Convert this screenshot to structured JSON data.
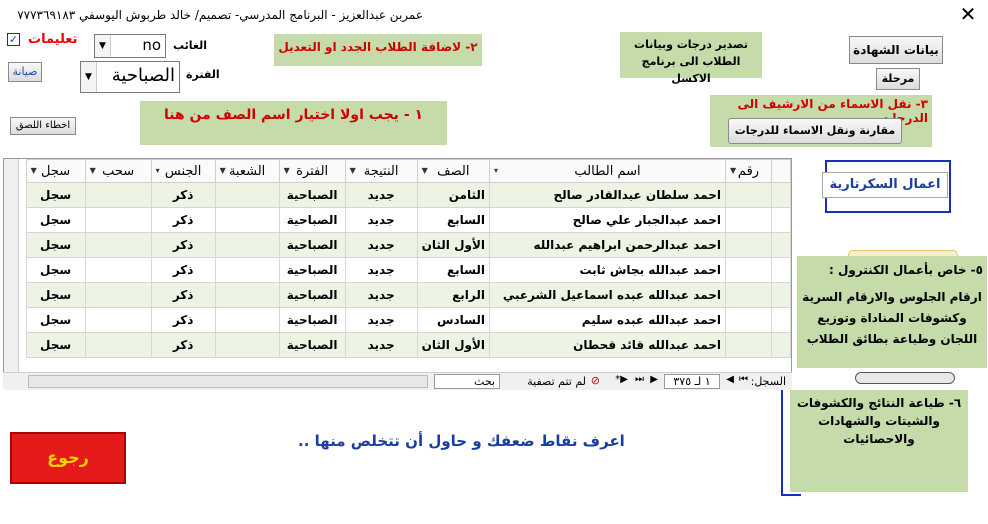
{
  "titlebar": {
    "title": "عمربن عبدالعزيز  - البرنامج المدرسي- تصميم/ خالد طربوش اليوسفي ٧٧٧٣٦٩١٨٣",
    "close": "✕"
  },
  "top_left": {
    "instructions_checked": "✓",
    "instructions_label": "تعليمات",
    "maintenance_button": "صيانة",
    "errors_button": "اخطاء اللصق"
  },
  "filters": {
    "absent_label": "الغائب",
    "absent_value": "no",
    "period_label": "الفترة",
    "period_value": "الصباحية"
  },
  "notes": {
    "add_students": "٢- لاضافة الطلاب الجدد او التعديل",
    "choose_class": "١ - يجب اولا اختيار اسم الصف من هنا",
    "export": "تصدير درجات وبيانات الطلاب الى برنامج الاكسل",
    "move_names": "٣- نقل الاسماء من الارشيف الى الدرجات",
    "control_title": "٥- خاص بأعمال الكنترول :",
    "control_body": "ارقام الجلوس والارقام السرية وكشوفات المناداة وتوزيع اللجان وطباعة بطائق الطلاب",
    "print_results": "٦-  طباعة النتائج والكشوفات والشيتات والشهادات والاحصائيات"
  },
  "buttons": {
    "certificate_data": "بيانات الشهادة",
    "stage": "مرحلة",
    "compare_move": "مقارنة ونقل الاسماء للدرجات",
    "secretary": "اعمال السكرتارية",
    "back": "رجوع"
  },
  "table": {
    "headers": [
      "رقم",
      "اسم الطالب",
      "الصف",
      "النتيجة",
      "الفترة",
      "الشعبة",
      "الجنس",
      "سحب",
      "سجل"
    ],
    "rows": [
      {
        "name": "احمد سلطان عبدالقادر صالح",
        "grade": "الثامن",
        "result": "جديد",
        "period": "الصباحية",
        "section": "",
        "gender": "ذكر",
        "withdraw": "",
        "record": "سجل"
      },
      {
        "name": "احمد عبدالجبار علي صالح",
        "grade": "السابع",
        "result": "جديد",
        "period": "الصباحية",
        "section": "",
        "gender": "ذكر",
        "withdraw": "",
        "record": "سجل"
      },
      {
        "name": "احمد عبدالرحمن ابراهيم عبدالله",
        "grade": "الأول الثان",
        "result": "جديد",
        "period": "الصباحية",
        "section": "",
        "gender": "ذكر",
        "withdraw": "",
        "record": "سجل"
      },
      {
        "name": "احمد عبدالله بجاش ثابت",
        "grade": "السابع",
        "result": "جديد",
        "period": "الصباحية",
        "section": "",
        "gender": "ذكر",
        "withdraw": "",
        "record": "سجل"
      },
      {
        "name": "احمد عبدالله عبده اسماعيل الشرعبي",
        "grade": "الرابع",
        "result": "جديد",
        "period": "الصباحية",
        "section": "",
        "gender": "ذكر",
        "withdraw": "",
        "record": "سجل"
      },
      {
        "name": "احمد عبدالله عبده سليم",
        "grade": "السادس",
        "result": "جديد",
        "period": "الصباحية",
        "section": "",
        "gender": "ذكر",
        "withdraw": "",
        "record": "سجل"
      },
      {
        "name": "احمد عبدالله قائد قحطان",
        "grade": "الأول الثان",
        "result": "جديد",
        "period": "الصباحية",
        "section": "",
        "gender": "ذكر",
        "withdraw": "",
        "record": "سجل"
      }
    ]
  },
  "navbar": {
    "record_label": "السجل:",
    "record_pos": "١ لـ ٣٧٥",
    "filter_status": "لم تتم تصفية",
    "search": "بحث"
  },
  "footer": {
    "motto": "اعرف نقاط ضعفك و حاول أن تتخلص منها .."
  },
  "colors": {
    "note_green": "#c5dcaa",
    "red": "#e00000",
    "back_button": "#e51a1a",
    "back_text": "#ffd400",
    "blue_border": "#1a2fb8"
  }
}
